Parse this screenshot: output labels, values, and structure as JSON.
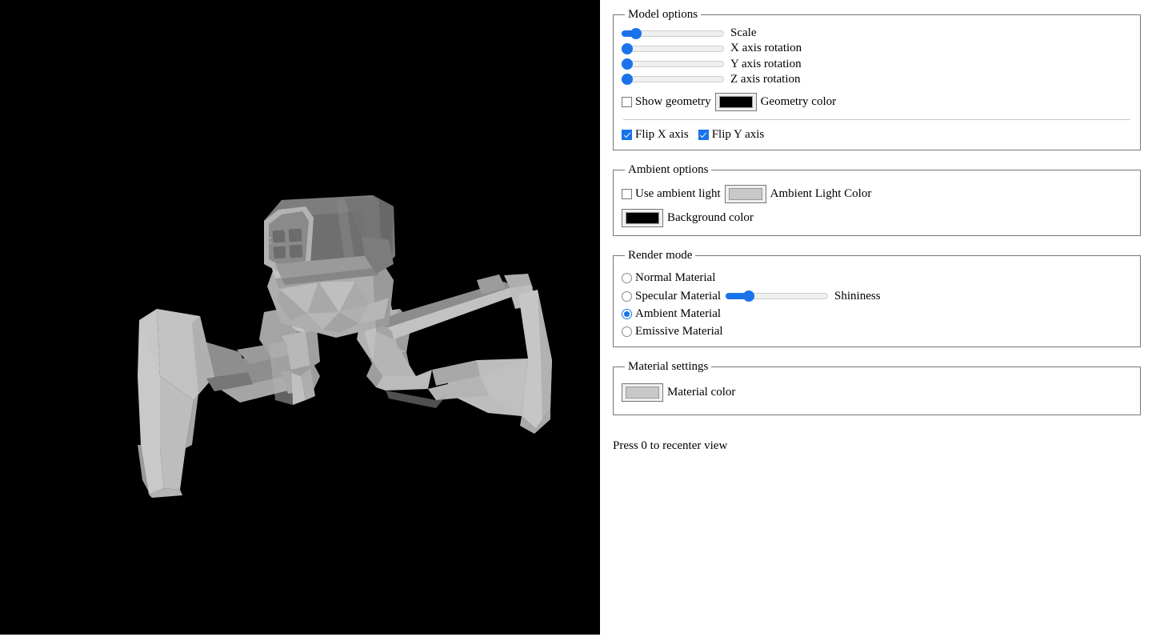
{
  "viewport": {
    "name": "3d-model-viewport",
    "background_color": "#000000",
    "model_name": "walker-robot-mech",
    "model_description": "Low-poly grey bipedal walker robot with boxy head module, grille face panel, ball-joint hips and two long curved legs",
    "model_colors": {
      "head_dark": "#6e6e6e",
      "head_mid": "#7c7c7c",
      "body_light": "#a8a8a8",
      "leg_light": "#bdbdbd",
      "leg_mid": "#a0a0a0",
      "leg_shadow": "#8a8a8a",
      "highlight": "#cfcfcf"
    }
  },
  "panel": {
    "model_options": {
      "legend": "Model options",
      "sliders": [
        {
          "id": "scale",
          "label": "Scale",
          "value": 10,
          "min": 0,
          "max": 100
        },
        {
          "id": "rot_x",
          "label": "X axis rotation",
          "value": 0,
          "min": 0,
          "max": 100
        },
        {
          "id": "rot_y",
          "label": "Y axis rotation",
          "value": 0,
          "min": 0,
          "max": 100
        },
        {
          "id": "rot_z",
          "label": "Z axis rotation",
          "value": 0,
          "min": 0,
          "max": 100
        }
      ],
      "show_geometry": {
        "label": "Show geometry",
        "checked": false
      },
      "geometry_color": {
        "label": "Geometry color",
        "value": "#000000"
      },
      "flip_x": {
        "label": "Flip X axis",
        "checked": true
      },
      "flip_y": {
        "label": "Flip Y axis",
        "checked": true
      }
    },
    "ambient_options": {
      "legend": "Ambient options",
      "use_ambient_light": {
        "label": "Use ambient light",
        "checked": false
      },
      "ambient_light_color": {
        "label": "Ambient Light Color",
        "value": "#c8c8c8"
      },
      "background_color": {
        "label": "Background color",
        "value": "#000000"
      }
    },
    "render_mode": {
      "legend": "Render mode",
      "options": [
        {
          "id": "normal",
          "label": "Normal Material",
          "selected": false
        },
        {
          "id": "specular",
          "label": "Specular Material",
          "selected": false
        },
        {
          "id": "ambient",
          "label": "Ambient Material",
          "selected": true
        },
        {
          "id": "emissive",
          "label": "Emissive Material",
          "selected": false
        }
      ],
      "shininess": {
        "label": "Shininess",
        "value": 23,
        "min": 0,
        "max": 100
      }
    },
    "material_settings": {
      "legend": "Material settings",
      "material_color": {
        "label": "Material color",
        "value": "#c8c8c8"
      }
    },
    "hint": "Press 0 to recenter view"
  },
  "theme": {
    "accent": "#1a73ea",
    "panel_bg": "#ffffff",
    "border": "#767676",
    "track": "#efefef"
  }
}
